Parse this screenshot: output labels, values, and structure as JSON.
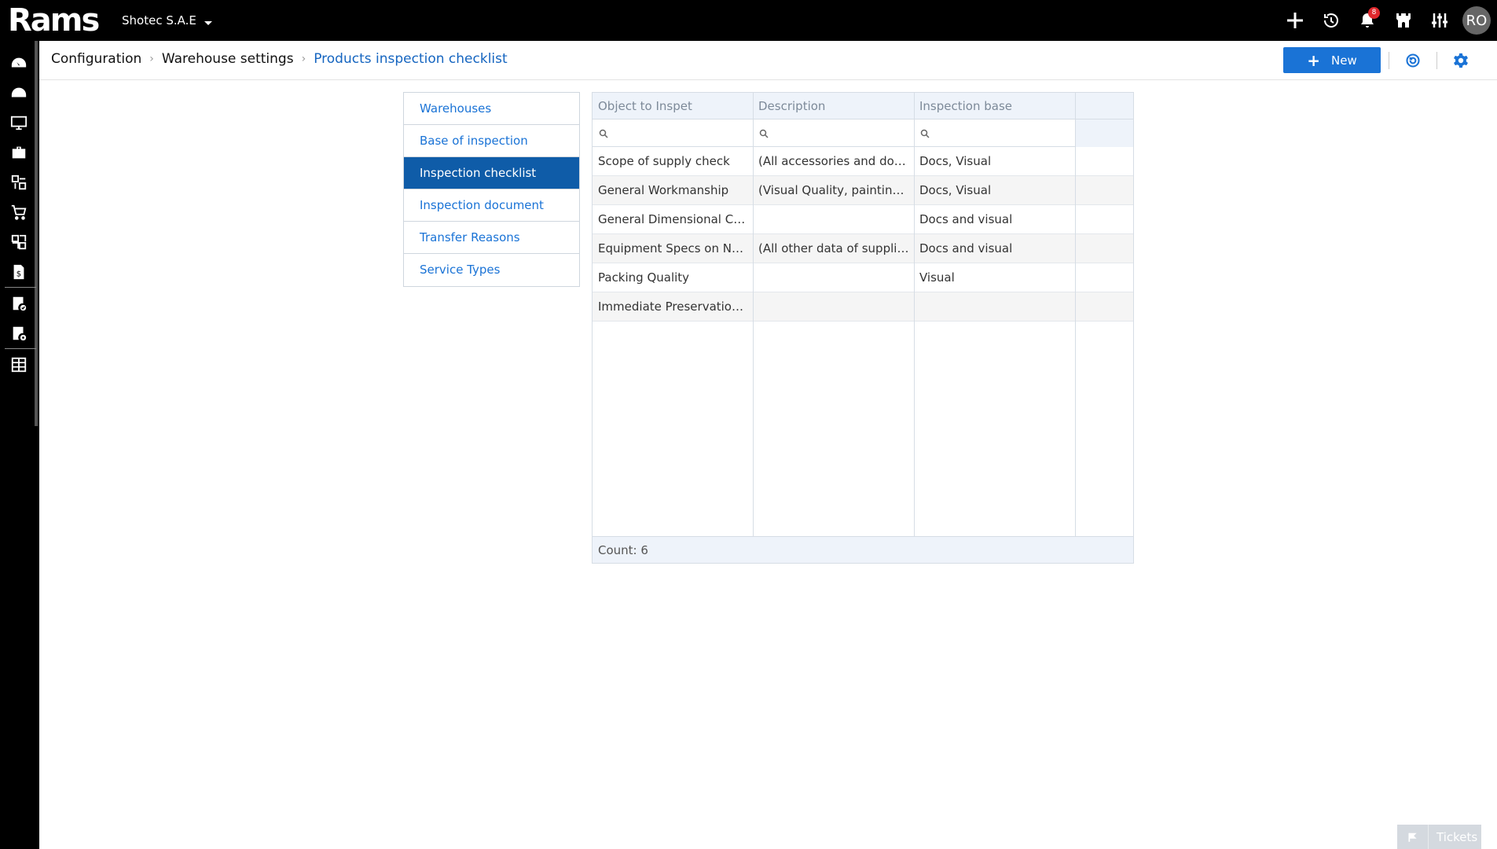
{
  "app": {
    "logo_text": "Rams",
    "company": "Shotec S.A.E",
    "notification_count": "8",
    "user_initials": "RO"
  },
  "header": {
    "breadcrumb": [
      "Configuration",
      "Warehouse settings",
      "Products inspection checklist"
    ],
    "new_label": "New"
  },
  "left_menu": {
    "items": [
      "Warehouses",
      "Base of inspection",
      "Inspection checklist",
      "Inspection document",
      "Transfer Reasons",
      "Service Types"
    ],
    "active": "Inspection checklist"
  },
  "grid": {
    "columns": [
      "Object to Inspet",
      "Description",
      "Inspection base"
    ],
    "rows": [
      [
        "Scope of supply check",
        "(All accessories and documents)",
        "Docs, Visual"
      ],
      [
        "General Workmanship",
        "(Visual Quality, painting, free of damage)",
        "Docs, Visual"
      ],
      [
        "General Dimensional Check",
        "",
        "Docs and visual"
      ],
      [
        "Equipment Specs on Name Plate",
        "(All other data of supplier on name plate)",
        "Docs and visual"
      ],
      [
        "Packing Quality",
        "",
        "Visual"
      ],
      [
        "Immediate Preservation Actions",
        "",
        ""
      ]
    ],
    "count_label": "Count: 6"
  },
  "tickets": {
    "label": "Tickets"
  },
  "colors": {
    "accent": "#1a73d6",
    "active_menu": "#0f5ca8",
    "topbar": "#000000"
  }
}
